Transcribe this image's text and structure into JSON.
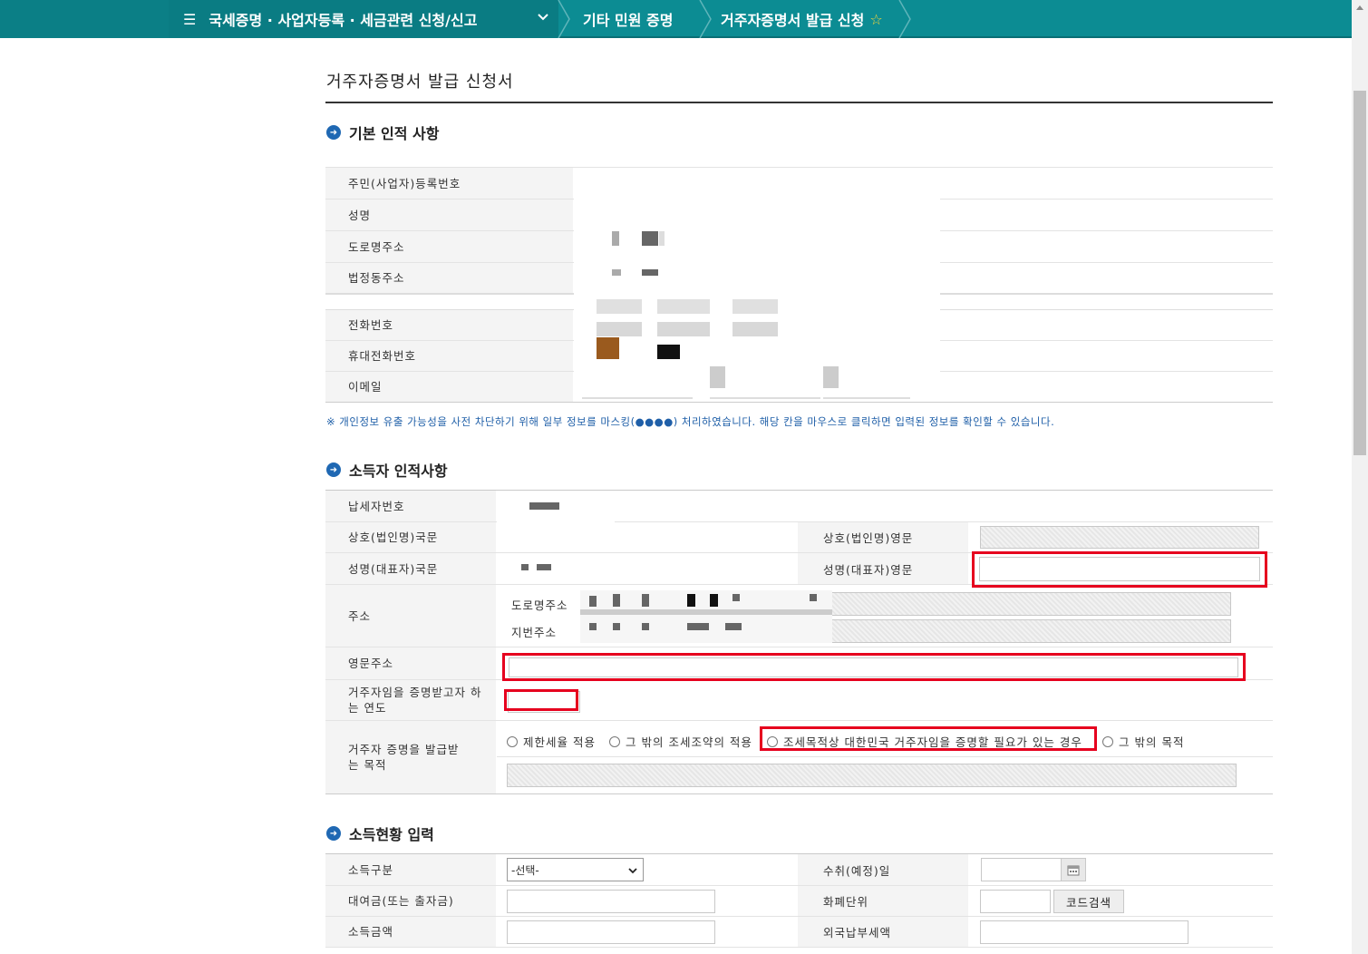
{
  "nav": {
    "menu_label": "국세증명 · 사업자등록 · 세금관련 신청/신고",
    "crumb2": "기타 민원 증명",
    "crumb3": "거주자증명서 발급 신청",
    "star": "☆"
  },
  "page": {
    "title": "거주자증명서 발급 신청서"
  },
  "basic": {
    "section_title": "기본 인적 사항",
    "labels": [
      "주민(사업자)등록번호",
      "성명",
      "도로명주소",
      "법정동주소",
      "전화번호",
      "휴대전화번호",
      "이메일"
    ]
  },
  "notice": "※ 개인정보 유출 가능성을 사전 차단하기 위해 일부 정보를 마스킹(●●●●) 처리하였습니다. 해당 칸을 마우스로 클릭하면 입력된 정보를 확인할 수 있습니다.",
  "income_person": {
    "section_title": "소득자 인적사항",
    "taxpayer_no": "납세자번호",
    "name_kr_biz": "상호(법인명)국문",
    "name_en_biz": "상호(법인명)영문",
    "rep_kr": "성명(대표자)국문",
    "rep_en": "성명(대표자)영문",
    "address": "주소",
    "road_addr": "도로명주소",
    "lot_addr": "지번주소",
    "eng_address": "영문주소",
    "year_label": "거주자임을 증명받고자 하는 연도",
    "purpose_label": "거주자 증명을 발급받는 목적",
    "purpose_options": [
      "제한세율 적용",
      "그 밖의 조세조약의 적용",
      "조세목적상 대한민국 거주자임을 증명할 필요가 있는 경우",
      "그 밖의 목적"
    ]
  },
  "income_status": {
    "section_title": "소득현황 입력",
    "type_label": "소득구분",
    "type_value": "-선택-",
    "receipt_date": "수취(예정)일",
    "loan_label": "대여금(또는 출자금)",
    "currency_label": "화폐단위",
    "code_search": "코드검색",
    "amount_label": "소득금액",
    "foreign_tax": "외국납부세액"
  }
}
